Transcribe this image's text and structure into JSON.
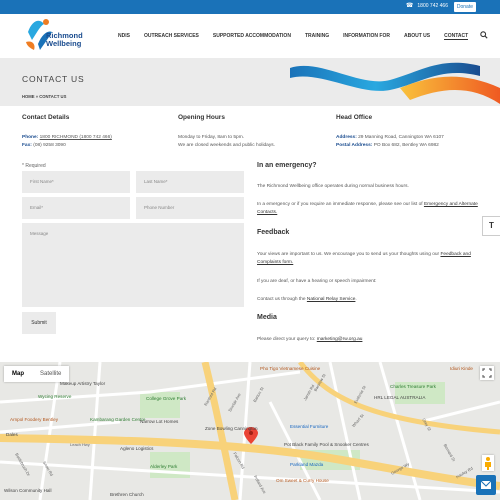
{
  "topbar": {
    "phone": "1800 742 466",
    "donate": "Donate"
  },
  "logo": {
    "line1": "Richmond",
    "line2": "Wellbeing"
  },
  "nav": [
    "NDIS",
    "OUTREACH SERVICES",
    "SUPPORTED ACCOMMODATION",
    "TRAINING",
    "INFORMATION FOR",
    "ABOUT US",
    "CONTACT"
  ],
  "hero": {
    "title": "CONTACT US",
    "breadcrumb": "HOME » CONTACT US"
  },
  "contact_details": {
    "title": "Contact Details",
    "phone_label": "Phone:",
    "phone_value": "1800 RICHMOND (1800 742 466)",
    "fax_label": "Fax:",
    "fax_value": "(08) 9258 3090"
  },
  "opening_hours": {
    "title": "Opening Hours",
    "line1": "Monday to Friday, 8am to 5pm.",
    "line2": "We are closed weekends and public holidays."
  },
  "head_office": {
    "title": "Head Office",
    "address_label": "Address:",
    "address_value": "29 Manning Road, Cannington WA 6107",
    "postal_label": "Postal Address:",
    "postal_value": "PO Box 682, Bentley WA 6982"
  },
  "form": {
    "required": "* Required",
    "first_name": "First Name*",
    "last_name": "Last Name*",
    "email": "Email*",
    "phone": "Phone Number",
    "message": "Message",
    "submit": "Submit"
  },
  "emergency": {
    "title": "In an emergency?",
    "p1": "The Richmond Wellbeing office operates during normal business hours.",
    "p2": "In a emergency or if you require an immediate response, please see our list of",
    "link": "Emergency and Alternate Contacts."
  },
  "feedback": {
    "title": "Feedback",
    "p1": "Your views are important to us. We encourage you to send us your thoughts using our",
    "link": "Feedback and Complaints form.",
    "p2": "If you are deaf, or have a hearing or speech impairment:",
    "p3": "Contact us through the",
    "relay_link": "National Relay Service"
  },
  "media": {
    "title": "Media",
    "text": "Please direct your query to:",
    "email": "marketing@rw.org.au"
  },
  "text_size_button": "T",
  "map": {
    "tab_map": "Map",
    "tab_satellite": "Satellite",
    "labels": [
      "Makeup Artistry Taylor",
      "Wycing Reserve",
      "Arnpol Foodery Bentley",
      "Kambarang Garden Centre",
      "College Grove Park",
      "Narrow Lot Homes",
      "Zone Bowling Cannington",
      "Essential Furniture",
      "Pot Black Family Pool & Snooker Centres",
      "Parkland Mazda",
      "Om Sweet & Curry House",
      "Charles Treasure Park",
      "HRL LEGAL AUSTRALIA",
      "Pho Tigo Vietnamese Cuisine",
      "Wilson Community Hall",
      "Brethren Church",
      "Agleno Logistics",
      "Alderley Park",
      "Idiuri Kinde",
      "Dales"
    ],
    "roads": [
      "Ranford Rd",
      "Sinclair Ave",
      "Barton St",
      "Jarrah Rd",
      "Falcon Rd",
      "Wharf St",
      "Leach Hwy",
      "Bottlebrush Dr",
      "Eudonia St",
      "Barstow St",
      "Pollard Ave",
      "Snow Rd",
      "George Wy",
      "Grey St",
      "Bernard St",
      "Hauley Rd"
    ]
  }
}
